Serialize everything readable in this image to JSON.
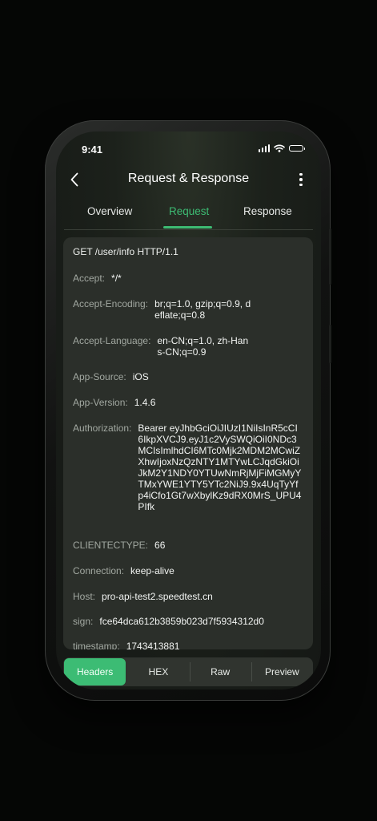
{
  "status_bar": {
    "time": "9:41"
  },
  "nav": {
    "title": "Request & Response"
  },
  "tabs": [
    {
      "label": "Overview"
    },
    {
      "label": "Request"
    },
    {
      "label": "Response"
    }
  ],
  "request_line": "GET /user/info HTTP/1.1",
  "headers": [
    {
      "key": "Accept:",
      "value": "*/*"
    },
    {
      "key": "Accept-Encoding:",
      "value": "br;q=1.0, gzip;q=0.9, deflate;q=0.8"
    },
    {
      "key": "Accept-Language:",
      "value": "en-CN;q=1.0, zh-Hans-CN;q=0.9"
    },
    {
      "key": "App-Source:",
      "value": "iOS"
    },
    {
      "key": "App-Version:",
      "value": "1.4.6"
    },
    {
      "key": "Authorization:",
      "value": "Bearer eyJhbGciOiJIUzI1NiIsInR5cCI6IkpXVCJ9.eyJ1c2VySWQiOiI0NDc3MCIsImlhdCI6MTc0Mjk2MDM2MCwiZXhwIjoxNzQzNTY1MTYwLCJqdGkiOiJkM2Y1NDY0YTUwNmRjMjFiMGMyYTMxYWE1YTY5YTc2NiJ9.9x4UqTyYfp4iCfo1Gt7wXbylKz9dRX0MrS_UPU4PIfk"
    },
    {
      "key": "CLIENTECTYPE:",
      "value": "66"
    },
    {
      "key": "Connection:",
      "value": "keep-alive"
    },
    {
      "key": "Host:",
      "value": "pro-api-test2.speedtest.cn"
    },
    {
      "key": "sign:",
      "value": "fce64dca612b3859b023d7f5934312d0"
    },
    {
      "key": "timestamp:",
      "value": "1743413881"
    }
  ],
  "bottom_tabs": [
    {
      "label": "Headers"
    },
    {
      "label": "HEX"
    },
    {
      "label": "Raw"
    },
    {
      "label": "Preview"
    }
  ],
  "colors": {
    "accent": "#3dbb73",
    "card": "#2b2f2a",
    "background": "#050605"
  },
  "icons": [
    "back-chevron-icon",
    "more-vertical-icon",
    "signal-icon",
    "wifi-icon",
    "battery-icon"
  ]
}
